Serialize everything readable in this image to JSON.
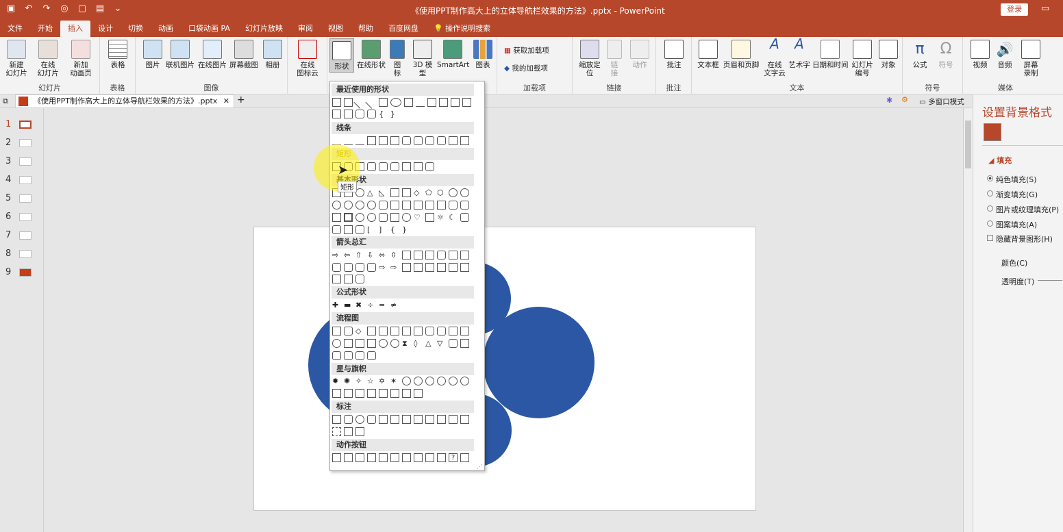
{
  "app": {
    "title": "《使用PPT制作高大上的立体导航栏效果的方法》.pptx  -  PowerPoint",
    "login_label": "登录"
  },
  "tabs": [
    "文件",
    "开始",
    "插入",
    "设计",
    "切换",
    "动画",
    "口袋动画 PA",
    "幻灯片放映",
    "审阅",
    "视图",
    "帮助",
    "百度网盘",
    "操作说明搜索"
  ],
  "ribbon": {
    "groups": {
      "slides": "幻灯片",
      "tables": "表格",
      "images": "图像",
      "addins": "加载项",
      "links": "链接",
      "comments": "批注",
      "text": "文本",
      "symbols": "符号",
      "media": "媒体"
    },
    "buttons": {
      "new_slide": "新建\n幻灯片",
      "online_slide": "在线\n幻灯片",
      "new_anim_page": "新加\n动画页",
      "table": "表格",
      "picture": "图片",
      "online_picture": "联机图片",
      "web_picture": "在线图片",
      "screenshot": "屏幕截图",
      "album": "相册",
      "online_icons": "在线\n图标云",
      "shapes": "形状",
      "online_shapes": "在线形状",
      "icons": "图\n标",
      "model3d": "3D 模\n型",
      "smartart": "SmartArt",
      "chart": "图表",
      "get_addins": "获取加载项",
      "my_addins": "我的加载项",
      "zoom": "缩放定\n位",
      "link": "链\n接",
      "action": "动作",
      "comment": "批注",
      "textbox": "文本框",
      "header_footer": "页眉和页脚",
      "online_text_cloud": "在线\n文字云",
      "wordart": "艺术字",
      "datetime": "日期和时间",
      "slide_number": "幻灯片\n编号",
      "object": "对象",
      "equation": "公式",
      "symbol": "符号",
      "video": "视频",
      "audio": "音频",
      "screen_record": "屏幕\n录制"
    }
  },
  "docbar": {
    "tab_label": "《使用PPT制作高大上的立体导航栏效果的方法》.pptx",
    "multiwindow": "多窗口模式"
  },
  "slides": [
    "1",
    "2",
    "3",
    "4",
    "5",
    "6",
    "7",
    "8",
    "9"
  ],
  "shapes_menu": {
    "sections": [
      "最近使用的形状",
      "线条",
      "矩形",
      "基本形状",
      "箭头总汇",
      "公式形状",
      "流程图",
      "星与旗帜",
      "标注",
      "动作按钮"
    ],
    "tooltip": "矩形"
  },
  "pane": {
    "title": "设置背景格式",
    "fill_header": "填充",
    "options": [
      "纯色填充(S)",
      "渐变填充(G)",
      "图片或纹理填充(P)",
      "图案填充(A)",
      "隐藏背景图形(H)"
    ],
    "color_label": "颜色(C)",
    "transparency_label": "透明度(T)"
  },
  "colors": {
    "accent": "#b7472a",
    "circle": "#2b57a4"
  }
}
